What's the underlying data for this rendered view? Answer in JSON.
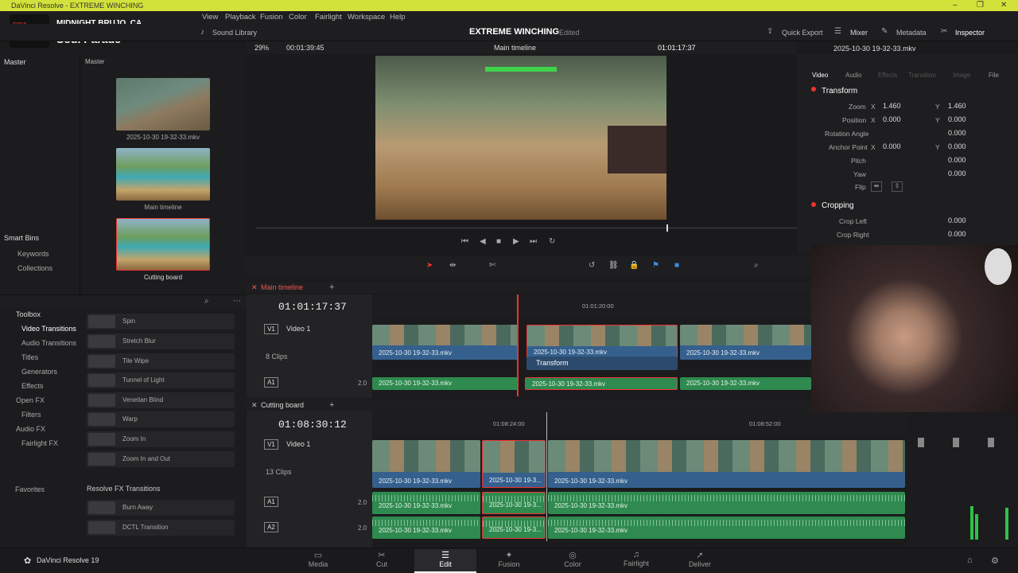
{
  "window": {
    "title": "DaVinci Resolve - EXTREME WINCHING"
  },
  "menu": {
    "items": [
      "View",
      "Playback",
      "Fusion",
      "Color",
      "Fairlight",
      "Workspace",
      "Help"
    ]
  },
  "overlay": {
    "stream_title": "MIDNIGHT BRUJO, CA",
    "logo_text": "Soul Parade"
  },
  "toolbar": {
    "sound_library": "Sound Library",
    "project_title": "EXTREME WINCHING",
    "edited": "Edited",
    "quick_export": "Quick Export",
    "mixer": "Mixer",
    "metadata": "Metadata",
    "inspector": "Inspector"
  },
  "viewer_bar": {
    "zoom": "29%",
    "duration": "00:01:39:45",
    "timeline_name": "Main timeline",
    "timecode": "01:01:17:37"
  },
  "inspector_panel": {
    "clip_name": "2025-10-30 19-32-33.mkv",
    "tabs": [
      "Video",
      "Audio",
      "Effects",
      "Transition",
      "Image",
      "File"
    ],
    "transform": "Transform",
    "zoom_label": "Zoom",
    "zoom_x": "1.460",
    "zoom_y": "1.460",
    "position_label": "Position",
    "position_x": "0.000",
    "position_y": "0.000",
    "rotation_label": "Rotation Angle",
    "rotation": "0.000",
    "anchor_label": "Anchor Point",
    "anchor_x": "0.000",
    "anchor_y": "0.000",
    "pitch_label": "Pitch",
    "pitch": "0.000",
    "yaw_label": "Yaw",
    "yaw": "0.000",
    "flip_label": "Flip",
    "cropping": "Cropping",
    "crop_left_label": "Crop Left",
    "crop_left": "0.000",
    "crop_right_label": "Crop Right",
    "crop_right": "0.000",
    "x": "X",
    "y": "Y"
  },
  "media_pool": {
    "master_left": "Master",
    "master_right": "Master",
    "clips": [
      {
        "name": "2025-10-30 19-32-33.mkv"
      },
      {
        "name": "Main timeline"
      },
      {
        "name": "Cutting board"
      }
    ],
    "smart_bins": "Smart Bins",
    "keywords": "Keywords",
    "collections": "Collections"
  },
  "toolbox": {
    "root": "Toolbox",
    "items": [
      "Video Transitions",
      "Audio Transitions",
      "Titles",
      "Generators",
      "Effects",
      "Open FX",
      "Filters",
      "Audio FX",
      "Fairlight FX",
      "Favorites"
    ],
    "fx": [
      "Spin",
      "Stretch Blur",
      "Tile Wipe",
      "Tunnel of Light",
      "Venetian Blind",
      "Warp",
      "Zoom In",
      "Zoom In and Out"
    ],
    "resolve_fx": "Resolve FX Transitions",
    "resolve_items": [
      "Burn Away",
      "DCTL Transition"
    ]
  },
  "timeline1": {
    "tab": "Main timeline",
    "timecode": "01:01:17:37",
    "ruler_label": "01:01:20:00",
    "v1": "V1",
    "video1": "Video 1",
    "clips_count": "8 Clips",
    "a1": "A1",
    "ch": "2.0",
    "clip_name": "2025-10-30 19-32-33.mkv",
    "transform_label": "Transform"
  },
  "timeline2": {
    "tab": "Cutting board",
    "timecode": "01:08:30:12",
    "ruler_a": "01:08:24:00",
    "ruler_b": "01:08:52:00",
    "v1": "V1",
    "video1": "Video 1",
    "clips_count": "13 Clips",
    "a1": "A1",
    "a2": "A2",
    "ch": "2.0",
    "clip_name": "2025-10-30 19-32-33.mkv",
    "clip_short": "2025-10-30 19-3..."
  },
  "pages": {
    "app_name": "DaVinci Resolve 19",
    "tabs": [
      "Media",
      "Cut",
      "Edit",
      "Fusion",
      "Color",
      "Fairlight",
      "Deliver"
    ],
    "active": "Edit"
  }
}
